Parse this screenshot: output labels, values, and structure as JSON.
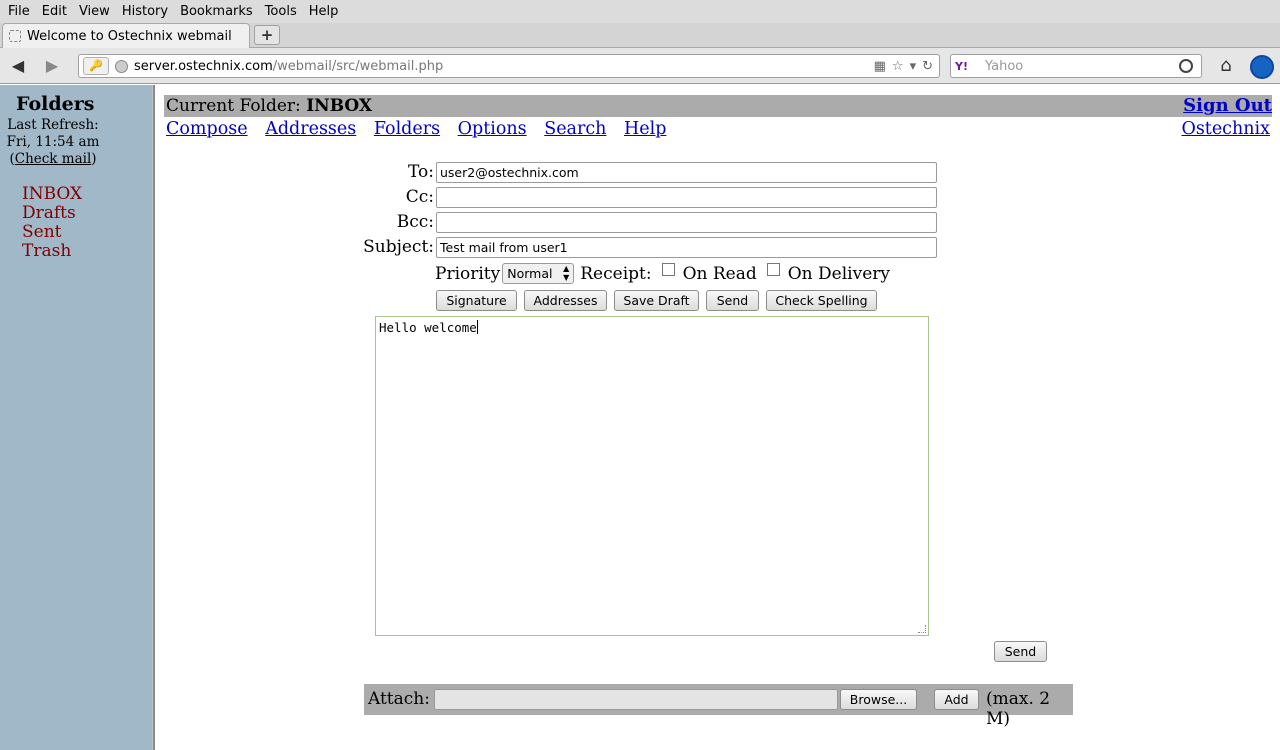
{
  "browser": {
    "menu": [
      "File",
      "Edit",
      "View",
      "History",
      "Bookmarks",
      "Tools",
      "Help"
    ],
    "tab_title": "Welcome to Ostechnix webmail",
    "new_tab_symbol": "+",
    "url_host": "server.ostechnix.com",
    "url_path": "/webmail/src/webmail.php",
    "search_engine": "Y!",
    "search_placeholder": "Yahoo"
  },
  "left_pane": {
    "title": "Folders",
    "last_refresh_label": "Last Refresh:",
    "last_refresh_time": "Fri, 11:54 am",
    "check_mail": "Check mail",
    "folders": [
      "INBOX",
      "Drafts",
      "Sent",
      "Trash"
    ]
  },
  "header": {
    "current_folder_label": "Current Folder:",
    "current_folder": "INBOX",
    "sign_out": "Sign Out",
    "links": [
      "Compose",
      "Addresses",
      "Folders",
      "Options",
      "Search",
      "Help"
    ],
    "org": "Ostechnix"
  },
  "compose": {
    "to_label": "To:",
    "to_value": "user2@ostechnix.com",
    "cc_label": "Cc:",
    "cc_value": "",
    "bcc_label": "Bcc:",
    "bcc_value": "",
    "subject_label": "Subject:",
    "subject_value": "Test mail from user1",
    "priority_label": "Priority",
    "priority_value": "Normal",
    "receipt_label": "Receipt:",
    "on_read_label": "On Read",
    "on_delivery_label": "On Delivery",
    "buttons": {
      "signature": "Signature",
      "addresses": "Addresses",
      "save_draft": "Save Draft",
      "send": "Send",
      "check_spelling": "Check Spelling"
    },
    "body": "Hello welcome",
    "send_bottom": "Send"
  },
  "attach": {
    "label": "Attach:",
    "browse": "Browse...",
    "add": "Add",
    "max": "(max. 2 M)"
  },
  "colors": {
    "folder_pane": "#a0b8c8",
    "folder_bar": "#ababab",
    "link": "#0000cc",
    "folder_link": "#800000"
  }
}
